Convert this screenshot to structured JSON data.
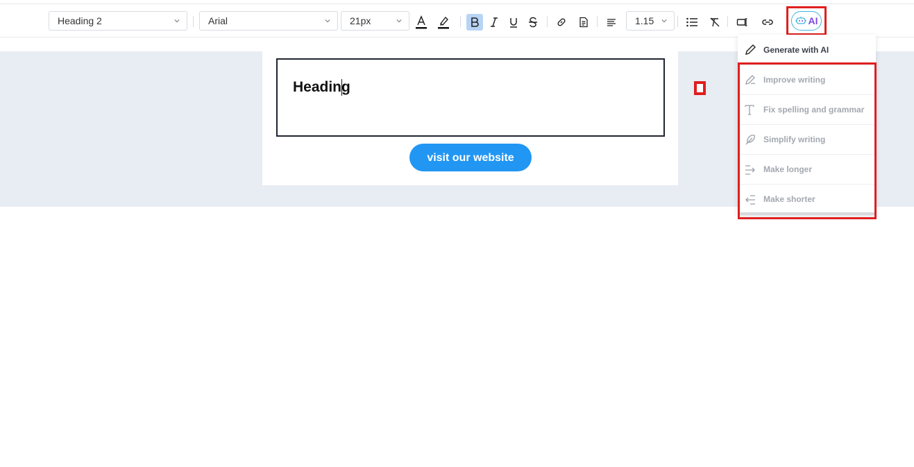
{
  "toolbar": {
    "block_style": "Heading 2",
    "font_family": "Arial",
    "font_size": "21px",
    "line_height": "1.15",
    "ai_label": "AI"
  },
  "editor": {
    "heading_text": "Heading",
    "cta_label": "visit our website"
  },
  "ai_menu": {
    "generate": "Generate with AI",
    "items": [
      {
        "label": "Improve writing",
        "icon": "pencil-icon"
      },
      {
        "label": "Fix spelling and grammar",
        "icon": "text-icon"
      },
      {
        "label": "Simplify writing",
        "icon": "feather-icon"
      },
      {
        "label": "Make longer",
        "icon": "arrow-right-icon"
      },
      {
        "label": "Make shorter",
        "icon": "arrow-left-icon"
      }
    ]
  },
  "colors": {
    "highlight_red": "#e01e1e",
    "cta_blue": "#2196f3",
    "ai_purple": "#7b4ae2",
    "canvas_bg": "#e8ecf3"
  }
}
